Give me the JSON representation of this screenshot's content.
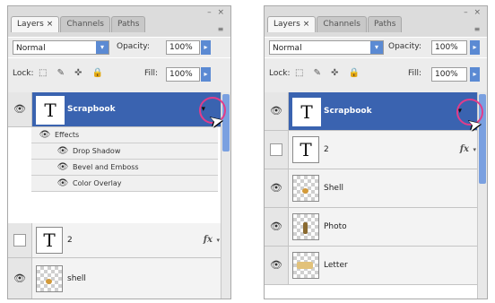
{
  "panel_left": {
    "window_controls": "– ×",
    "tabs": [
      {
        "label": "Layers",
        "close": "×",
        "active": true
      },
      {
        "label": "Channels",
        "close": "",
        "active": false
      },
      {
        "label": "Paths",
        "close": "",
        "active": false
      }
    ],
    "blend_mode": "Normal",
    "opacity_label": "Opacity:",
    "opacity_value": "100%",
    "lock_label": "Lock:",
    "fill_label": "Fill:",
    "fill_value": "100%",
    "layers": [
      {
        "name": "Scrapbook",
        "thumb": "T",
        "visible": true,
        "selected": true
      },
      {
        "name": "Effects",
        "is_effects_header": true
      },
      {
        "name": "Drop Shadow",
        "is_effect": true
      },
      {
        "name": "Bevel and Emboss",
        "is_effect": true
      },
      {
        "name": "Color Overlay",
        "is_effect": true
      },
      {
        "name": "2",
        "thumb": "T",
        "visible": false,
        "fx": "fx"
      },
      {
        "name": "shell",
        "thumb": "",
        "visible": true
      }
    ]
  },
  "panel_right": {
    "window_controls": "– ×",
    "tabs": [
      {
        "label": "Layers",
        "close": "×",
        "active": true
      },
      {
        "label": "Channels",
        "close": "",
        "active": false
      },
      {
        "label": "Paths",
        "close": "",
        "active": false
      }
    ],
    "blend_mode": "Normal",
    "opacity_label": "Opacity:",
    "opacity_value": "100%",
    "lock_label": "Lock:",
    "fill_label": "Fill:",
    "fill_value": "100%",
    "layers": [
      {
        "name": "Scrapbook",
        "thumb": "T",
        "visible": true,
        "selected": true
      },
      {
        "name": "2",
        "thumb": "T",
        "visible": false,
        "fx": "fx"
      },
      {
        "name": "Shell",
        "thumb": "",
        "visible": true
      },
      {
        "name": "Photo",
        "thumb": "",
        "visible": true
      },
      {
        "name": "Letter",
        "thumb": "",
        "visible": true
      }
    ]
  },
  "icons": {
    "eye": "👁",
    "dropdown": "▾",
    "flyout": "▸",
    "lock_icons": "⬚ ✎ ✜ 🔒",
    "panel_menu": "≡",
    "cursor": "➤"
  },
  "colors": {
    "selection": "#3a63b0",
    "highlight_circle": "#e23c8a",
    "accent_blue": "#5b8ad3"
  }
}
